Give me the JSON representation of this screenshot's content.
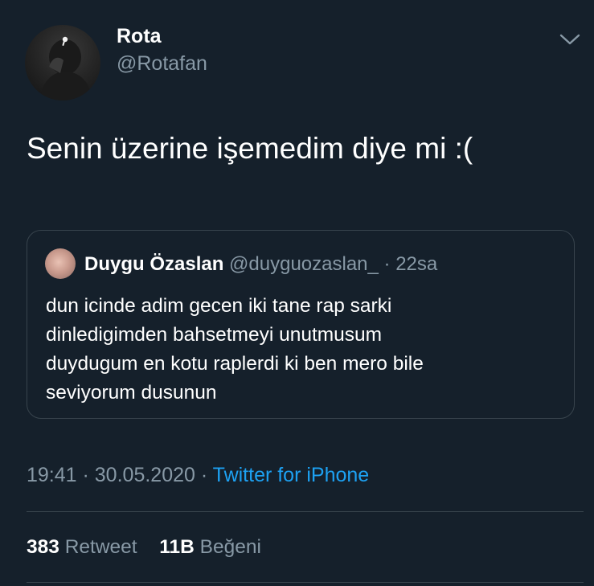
{
  "author": {
    "name": "Rota",
    "handle": "@Rotafan"
  },
  "tweet": {
    "text": "Senin üzerine işemedim diye mi :("
  },
  "quoted_tweet": {
    "name": "Duygu Özaslan",
    "handle": "@duyguozaslan_",
    "separator": " · ",
    "time": "22sa",
    "lines": [
      "dun icinde adim gecen iki tane rap sarki",
      "dinledigimden bahsetmeyi unutmusum",
      "duydugum en kotu raplerdi ki ben mero bile",
      "seviyorum dusunun"
    ]
  },
  "meta": {
    "time": "19:41",
    "separator": " · ",
    "date": "30.05.2020",
    "source": "Twitter for iPhone"
  },
  "stats": {
    "retweets_count": "383",
    "retweets_label": "Retweet",
    "likes_count": "11B",
    "likes_label": "Beğeni"
  },
  "icons": {
    "caret": "chevron-down-icon"
  },
  "colors": {
    "background": "#15202b",
    "secondary_text": "#8899a6",
    "link": "#1da1f2",
    "border": "#38444d"
  }
}
